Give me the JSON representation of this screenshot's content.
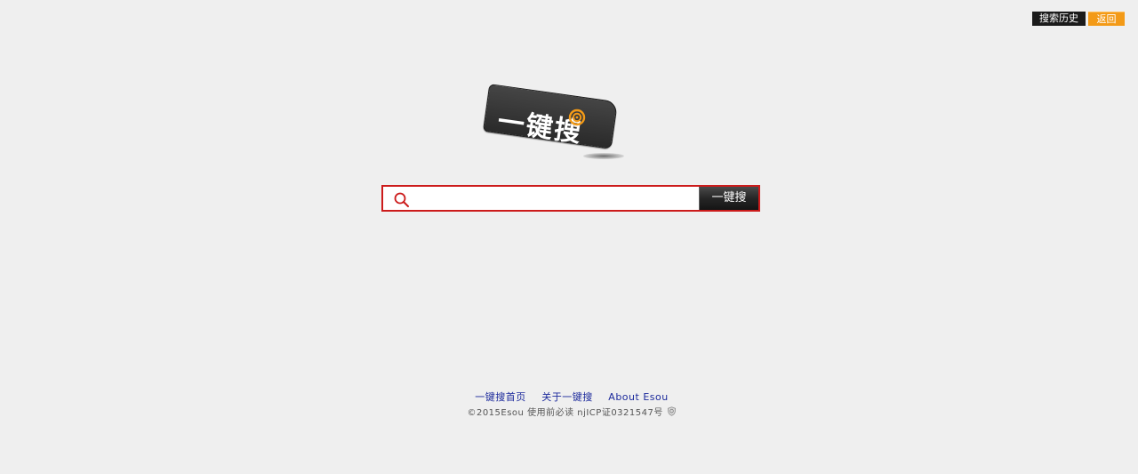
{
  "header": {
    "history_label": "搜索历史",
    "back_label": "返回"
  },
  "logo": {
    "text": "一键搜"
  },
  "search": {
    "value": "",
    "placeholder": "",
    "button_label": "一键搜"
  },
  "footer": {
    "links": [
      {
        "label": "一键搜首页"
      },
      {
        "label": "关于一键搜"
      },
      {
        "label": "About Esou"
      }
    ],
    "copyright": "©2015Esou 使用前必读 njICP证0321547号"
  },
  "colors": {
    "accent_red": "#cc1b1b",
    "back_orange": "#f39a17",
    "link_blue": "#1c2a9c",
    "background": "#efefef"
  },
  "icons": {
    "search": "search-icon",
    "logo_ring": "target-ring-icon",
    "police_badge": "police-badge-icon"
  }
}
